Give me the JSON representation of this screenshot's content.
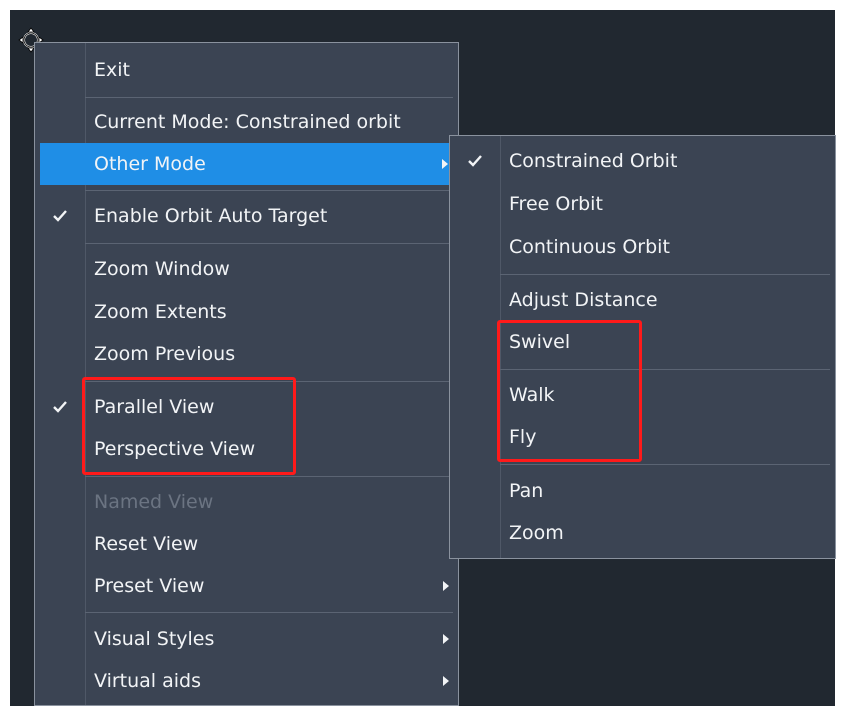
{
  "main_menu": {
    "items": [
      {
        "label": "Exit"
      },
      {
        "label": "Current Mode: Constrained orbit"
      },
      {
        "label": "Other Mode"
      },
      {
        "label": "Enable Orbit Auto Target"
      },
      {
        "label": "Zoom Window"
      },
      {
        "label": "Zoom Extents"
      },
      {
        "label": "Zoom Previous"
      },
      {
        "label": "Parallel View"
      },
      {
        "label": "Perspective View"
      },
      {
        "label": "Named View"
      },
      {
        "label": "Reset View"
      },
      {
        "label": "Preset View"
      },
      {
        "label": "Visual Styles"
      },
      {
        "label": "Virtual aids"
      }
    ]
  },
  "sub_menu": {
    "items": [
      {
        "label": "Constrained Orbit"
      },
      {
        "label": "Free Orbit"
      },
      {
        "label": "Continuous Orbit"
      },
      {
        "label": "Adjust Distance"
      },
      {
        "label": "Swivel"
      },
      {
        "label": "Walk"
      },
      {
        "label": "Fly"
      },
      {
        "label": "Pan"
      },
      {
        "label": "Zoom"
      }
    ]
  },
  "colors": {
    "canvas": "#212830",
    "menu": "#3b4453",
    "highlight": "#1f8ee6",
    "annotation": "#ff1a1a"
  },
  "icons": [
    "orbit-cursor-icon",
    "check-icon",
    "submenu-arrow-icon"
  ]
}
